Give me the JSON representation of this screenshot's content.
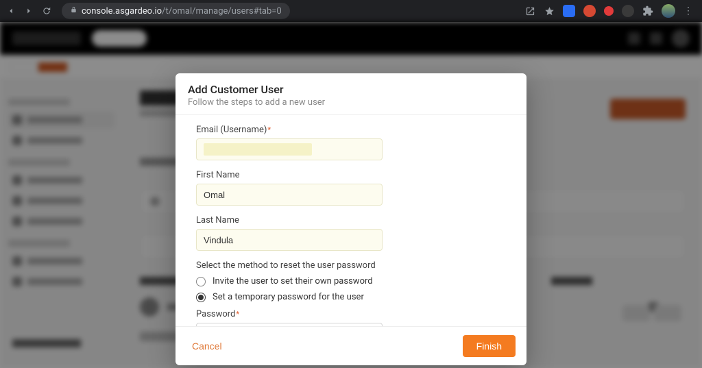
{
  "browser": {
    "url_host": "console.asgardeo.io",
    "url_path": "/t/omal/manage/users#tab=0"
  },
  "modal": {
    "title": "Add Customer User",
    "subtitle": "Follow the steps to add a new user",
    "email_label": "Email (Username)",
    "email_value": "",
    "first_name_label": "First Name",
    "first_name_value": "Omal",
    "last_name_label": "Last Name",
    "last_name_value": "Vindula",
    "pw_section_label": "Select the method to reset the user password",
    "radio_invite": "Invite the user to set their own password",
    "radio_temp": "Set a temporary password for the user",
    "selected_radio": "temp",
    "password_label": "Password",
    "password_value": "••••••••••",
    "cancel": "Cancel",
    "finish": "Finish"
  },
  "colors": {
    "accent": "#f47b20"
  }
}
